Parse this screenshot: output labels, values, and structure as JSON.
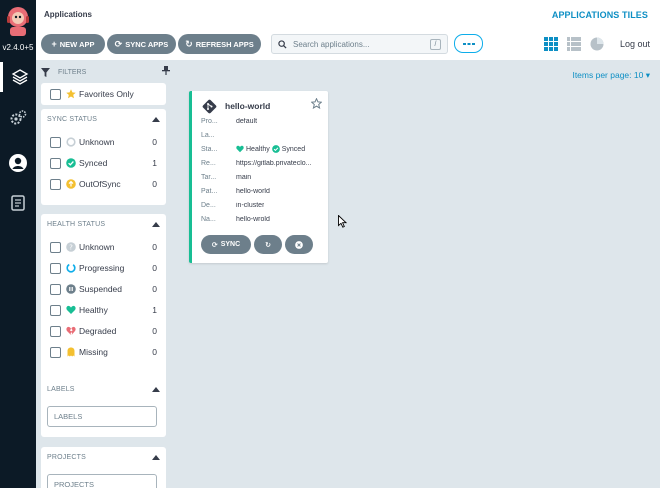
{
  "nav": {
    "version": "v2.4.0+5"
  },
  "header": {
    "title": "Applications",
    "view_title": "APPLICATIONS TILES",
    "new_app": "NEW APP",
    "sync_apps": "SYNC APPS",
    "refresh_apps": "REFRESH APPS",
    "search_placeholder": "Search applications...",
    "search_shortcut": "/",
    "logout": "Log out"
  },
  "filters": {
    "label": "FILTERS",
    "favorites": "Favorites Only",
    "sync_status": {
      "title": "SYNC STATUS",
      "items": [
        {
          "label": "Unknown",
          "count": "0"
        },
        {
          "label": "Synced",
          "count": "1"
        },
        {
          "label": "OutOfSync",
          "count": "0"
        }
      ]
    },
    "health_status": {
      "title": "HEALTH STATUS",
      "items": [
        {
          "label": "Unknown",
          "count": "0"
        },
        {
          "label": "Progressing",
          "count": "0"
        },
        {
          "label": "Suspended",
          "count": "0"
        },
        {
          "label": "Healthy",
          "count": "1"
        },
        {
          "label": "Degraded",
          "count": "0"
        },
        {
          "label": "Missing",
          "count": "0"
        }
      ]
    },
    "labels": {
      "title": "LABELS",
      "placeholder": "LABELS"
    },
    "projects": {
      "title": "PROJECTS",
      "placeholder": "PROJECTS"
    }
  },
  "main": {
    "items_per_page": "Items per page: 10"
  },
  "card": {
    "name": "hello-world",
    "rows": [
      {
        "key": "Pro...",
        "value": "default"
      },
      {
        "key": "La...",
        "value": ""
      },
      {
        "key": "Sta...",
        "health": "Healthy",
        "sync": "Synced"
      },
      {
        "key": "Re...",
        "value": "https://gitlab.privateclo..."
      },
      {
        "key": "Tar...",
        "value": "main"
      },
      {
        "key": "Pat...",
        "value": "hello-world"
      },
      {
        "key": "De...",
        "value": "in-cluster"
      },
      {
        "key": "Na...",
        "value": "hello-wrold"
      }
    ],
    "sync_label": "SYNC"
  },
  "colors": {
    "accent": "#0d8fc4",
    "healthy": "#18be94",
    "button": "#6d7f8b",
    "degraded": "#e96d76",
    "out_of_sync": "#f4c030",
    "nav_bg": "#0c1a26"
  }
}
